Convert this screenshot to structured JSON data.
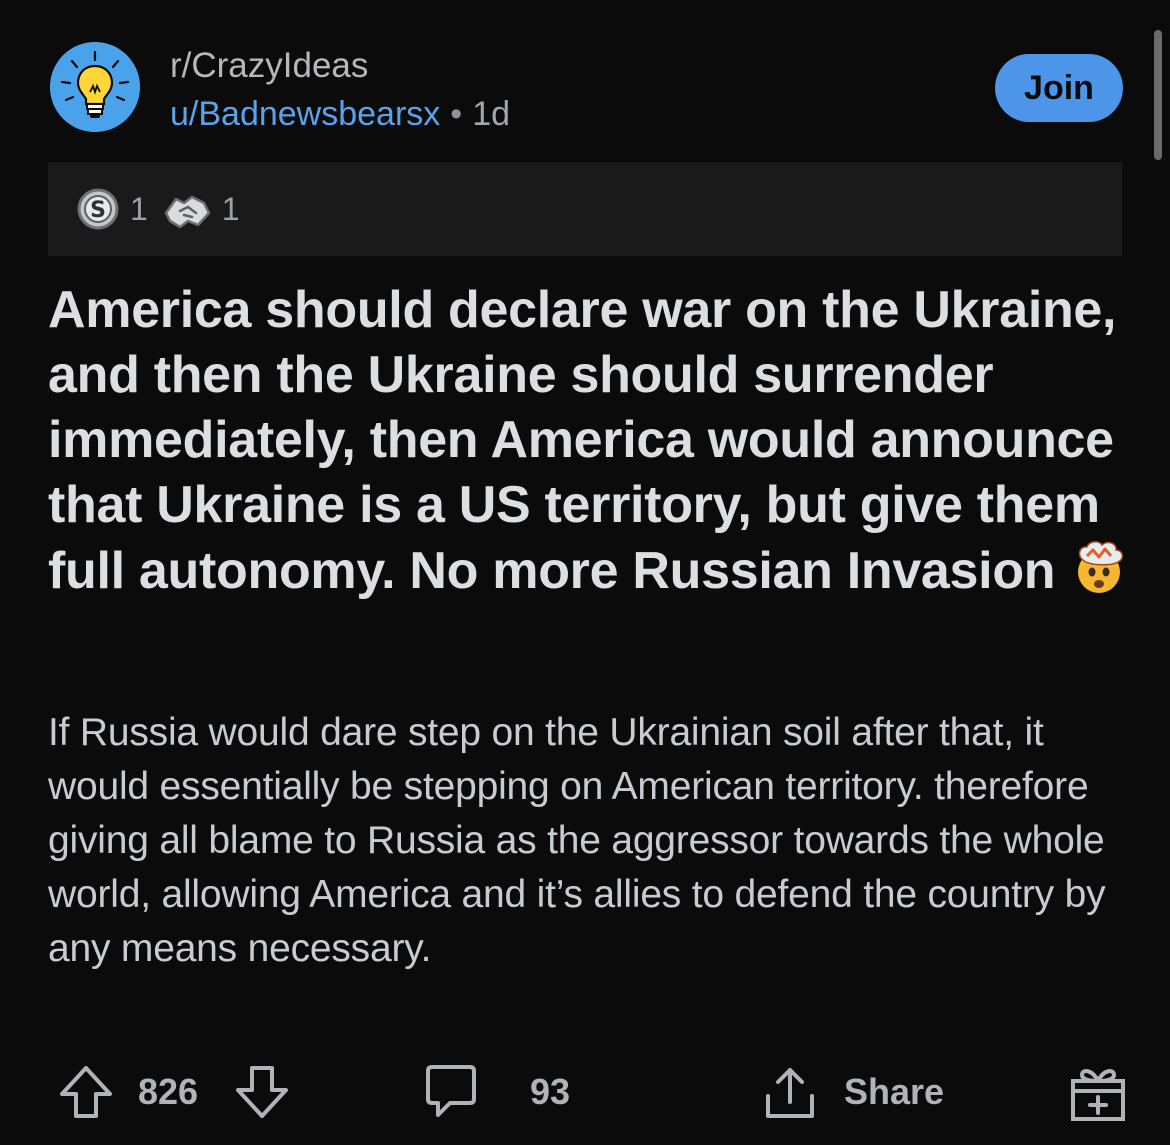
{
  "post": {
    "subreddit": "r/CrazyIdeas",
    "author": "u/Badnewsbearsx",
    "separator": "•",
    "age": "1d",
    "join_label": "Join",
    "awards": [
      {
        "icon": "silver-award-icon",
        "count": "1"
      },
      {
        "icon": "handshake-award-icon",
        "count": "1"
      }
    ],
    "title": "America should declare war on the Ukraine, and then the Ukraine should surrender immediately, then America would announce that Ukraine is a US territory, but give them full autonomy. No more Russian Invasion",
    "title_emoji": "exploding-head-emoji",
    "body": "If Russia would dare step on the Ukrainian soil after that, it would essentially be stepping on American territory. therefore giving all blame to Russia as the aggressor towards the whole world, allowing America and it’s allies to defend the country by any means necessary."
  },
  "actions": {
    "upvotes": "826",
    "comments": "93",
    "share_label": "Share"
  },
  "colors": {
    "background": "#0b0b0b",
    "join_button": "#4d95e8",
    "username": "#5aa2ea",
    "avatar": "#4aa3ea",
    "awards_bar": "#1a1a1b"
  }
}
